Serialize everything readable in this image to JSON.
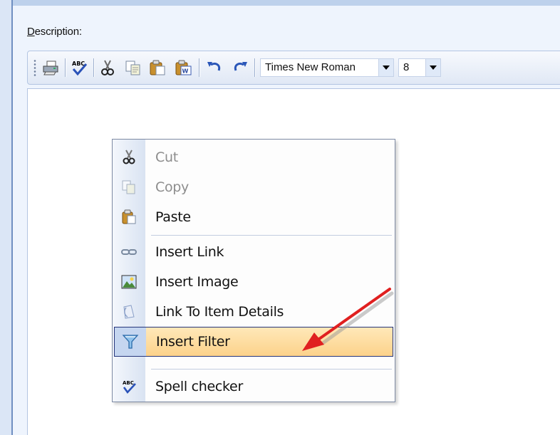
{
  "form": {
    "description_accel": "D",
    "description_rest": "escription:"
  },
  "toolbar": {
    "buttons": [
      "print-icon",
      "spell-check-icon",
      "cut-icon",
      "copy-icon",
      "paste-icon",
      "paste-word-icon",
      "undo-icon",
      "redo-icon"
    ],
    "font_name": "Times New Roman",
    "font_size": "8"
  },
  "context_menu": {
    "items": [
      {
        "label": "Cut",
        "icon": "cut-icon",
        "enabled": false
      },
      {
        "label": "Copy",
        "icon": "copy-icon",
        "enabled": false
      },
      {
        "label": "Paste",
        "icon": "paste-icon",
        "enabled": true
      },
      {
        "label": "Insert Link",
        "icon": "link-icon",
        "enabled": true
      },
      {
        "label": "Insert Image",
        "icon": "image-icon",
        "enabled": true
      },
      {
        "label": "Link To Item Details",
        "icon": "item-link-icon",
        "enabled": true
      },
      {
        "label": "Insert Filter",
        "icon": "filter-icon",
        "enabled": true,
        "highlighted": true
      },
      {
        "label": "Spell checker",
        "icon": "spell-check-icon",
        "enabled": true
      }
    ]
  },
  "colors": {
    "highlight": "#fcd28a",
    "highlight_border": "#25357a",
    "annotation_arrow": "#e02020"
  }
}
